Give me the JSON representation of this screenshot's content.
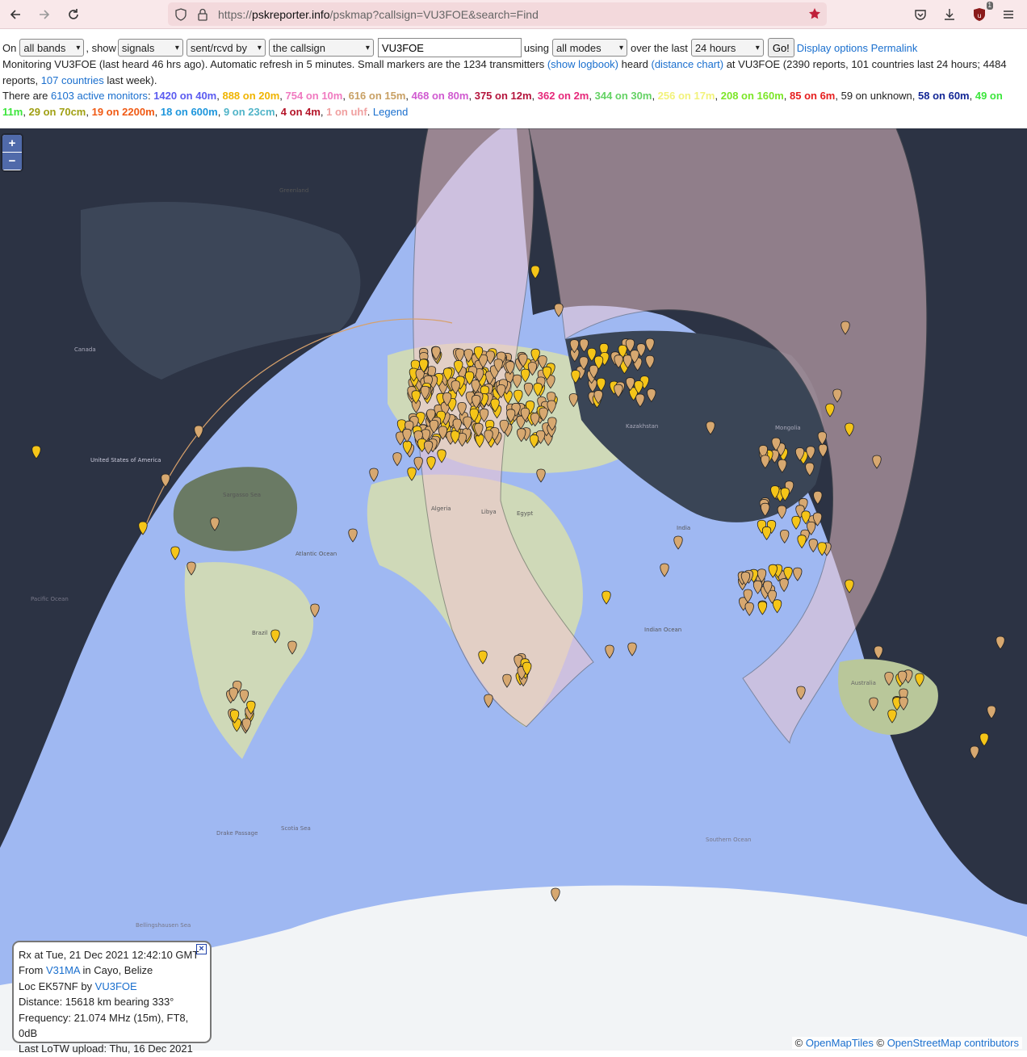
{
  "browser": {
    "url_scheme": "https://",
    "url_host": "pskreporter.info",
    "url_path": "/pskmap?callsign=VU3FOE&search=Find",
    "extension_badge": "1"
  },
  "controls": {
    "on_label": "On",
    "band_select": "all bands",
    "show_label": ", show",
    "signals_select": "signals",
    "sentrcvd_select": "sent/rcvd by",
    "callsign_select": "the callsign",
    "callsign_value": "VU3FOE",
    "using_label": "using",
    "mode_select": "all modes",
    "over_label": "over the last",
    "period_select": "24 hours",
    "go_button": "Go!",
    "display_options_link": "Display options",
    "permalink_link": "Permalink"
  },
  "info": {
    "text1": "Monitoring VU3FOE (last heard 46 hrs ago). Automatic refresh in 5 minutes. Small markers are the 1234 transmitters ",
    "show_logbook_link": "(show logbook)",
    "text2": " heard ",
    "distance_chart_link": "(distance chart)",
    "text3": " at VU3FOE (2390 reports, 101 countries last 24 hours; 4484 reports, ",
    "countries_link": "107 countries",
    "text4": " last week)."
  },
  "bands": {
    "prefix": "There are ",
    "monitors_link": "6103 active monitors",
    "colon": ":",
    "items": [
      {
        "text": "1420 on 40m",
        "color": "#5b5bf0"
      },
      {
        "text": "888 on 20m",
        "color": "#f0b400"
      },
      {
        "text": "754 on 10m",
        "color": "#f07ac0"
      },
      {
        "text": "616 on 15m",
        "color": "#c8a064"
      },
      {
        "text": "468 on 80m",
        "color": "#d05ad0"
      },
      {
        "text": "375 on 12m",
        "color": "#b4143c"
      },
      {
        "text": "362 on 2m",
        "color": "#e6287a"
      },
      {
        "text": "344 on 30m",
        "color": "#64d264"
      },
      {
        "text": "256 on 17m",
        "color": "#f2f27a"
      },
      {
        "text": "208 on 160m",
        "color": "#7ce628"
      },
      {
        "text": "85 on 6m",
        "color": "#e62020"
      },
      {
        "text": "59 on unknown",
        "color": "#222222",
        "plain": true
      },
      {
        "text": "58 on 60m",
        "color": "#142896"
      },
      {
        "text": "49 on 11m",
        "color": "#3ce63c"
      },
      {
        "text": "29 on 70cm",
        "color": "#a0a014"
      },
      {
        "text": "19 on 2200m",
        "color": "#f05a14"
      },
      {
        "text": "18 on 600m",
        "color": "#1e96dc"
      },
      {
        "text": "9 on 23cm",
        "color": "#50b4c8"
      },
      {
        "text": "4 on 4m",
        "color": "#b41428"
      },
      {
        "text": "1 on uhf",
        "color": "#f0a0a0"
      }
    ],
    "legend_link": "Legend"
  },
  "map": {
    "zoom_in": "+",
    "zoom_out": "−",
    "labels": {
      "greenland": "Greenland",
      "canada": "Canada",
      "usa": "United States of America",
      "sargasso": "Sargasso Sea",
      "atlantic": "Atlantic Ocean",
      "pacific": "Pacific Ocean",
      "indian": "Indian Ocean",
      "southern": "Southern Ocean",
      "australia": "Australia",
      "brazil": "Brazil",
      "algeria": "Algeria",
      "libya": "Libya",
      "egypt": "Egypt",
      "mongolia": "Mongolia",
      "kazakhstan": "Kazakhstan",
      "india": "India",
      "scotia": "Scotia Sea",
      "drake": "Drake Passage",
      "bellingshausen": "Bellingshausen Sea"
    },
    "attribution_prefix": "© ",
    "attribution_link1": "OpenMapTiles",
    "attribution_mid": " © ",
    "attribution_link2": "OpenStreetMap contributors"
  },
  "popup": {
    "line1": "Rx at Tue, 21 Dec 2021 12:42:10 GMT",
    "from_label": "From ",
    "from_link": "V31MA",
    "from_rest": " in Cayo, Belize",
    "loc_label": "Loc EK57NF by ",
    "loc_link": "VU3FOE",
    "distance": "Distance: 15618 km bearing 333°",
    "frequency": "Frequency: 21.074 MHz (15m), FT8, 0dB",
    "lotw": "Last LoTW upload: Thu, 16 Dec 2021",
    "close": "×"
  }
}
